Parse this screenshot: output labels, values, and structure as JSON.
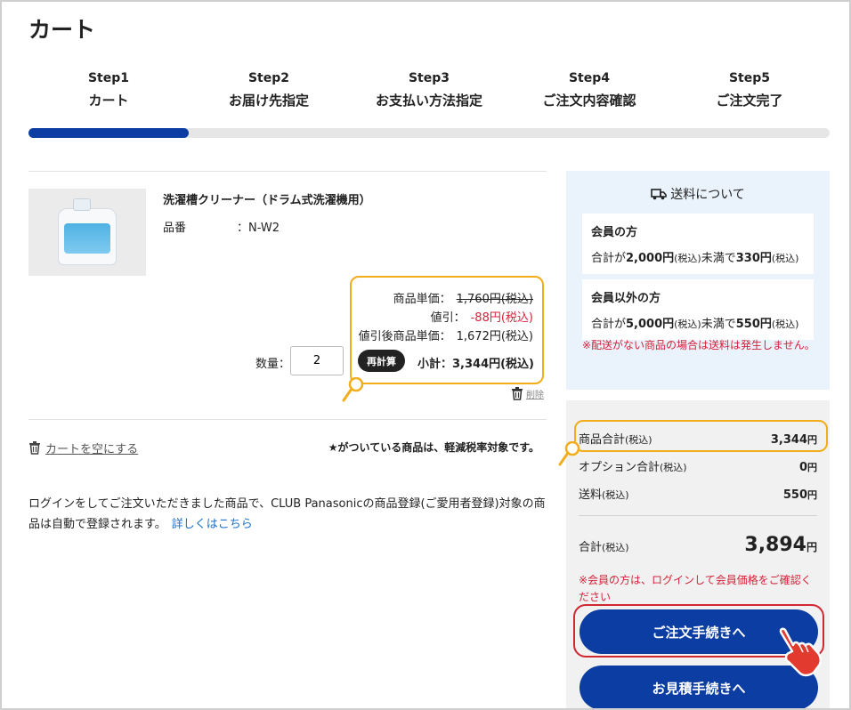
{
  "page": {
    "title": "カート"
  },
  "steps": [
    {
      "num": "Step1",
      "label": "カート"
    },
    {
      "num": "Step2",
      "label": "お届け先指定"
    },
    {
      "num": "Step3",
      "label": "お支払い方法指定"
    },
    {
      "num": "Step4",
      "label": "ご注文内容確認"
    },
    {
      "num": "Step5",
      "label": "ご注文完了"
    }
  ],
  "progress": {
    "current_step": 1,
    "total_steps": 5,
    "fraction": 0.2
  },
  "item": {
    "name": "洗濯槽クリーナー（ドラム式洗濯機用）",
    "hinban_label": "品番",
    "hinban_value": "：N-W2",
    "unit_price_label": "商品単価：",
    "unit_price": "1,760円(税込)",
    "discount_label": "値引：",
    "discount": "-88円(税込)",
    "discounted_price_label": "値引後商品単価：",
    "discounted_price": "1,672円(税込)",
    "qty_label": "数量：",
    "qty": "2",
    "recalc_label": "再計算",
    "subtotal": "小計：3,344円(税込)",
    "delete_label": "削除"
  },
  "cart": {
    "empty_label": "カートを空にする",
    "tax_note": "★がついている商品は、軽減税率対象です。",
    "login_note": "ログインをしてご注文いただきました商品で、CLUB Panasonicの商品登録(ご愛用者登録)対象の商品は自動で登録されます。",
    "details_link": "詳しくはこちら"
  },
  "shipping": {
    "title": "送料について",
    "member_title": "会員の方",
    "member_text_1": "合計が",
    "member_amount": "2,000円",
    "member_text_2": "(税込)",
    "member_text_3": "未満で",
    "member_fee": "330円",
    "member_text_4": "(税込)",
    "nonmember_title": "会員以外の方",
    "nonmember_text_1": "合計が",
    "nonmember_amount": "5,000円",
    "nonmember_text_2": "(税込)",
    "nonmember_text_3": "未満で",
    "nonmember_fee": "550円",
    "nonmember_text_4": "(税込)",
    "warning": "※配送がない商品の場合は送料は発生しません。"
  },
  "summary": {
    "goods_label": "商品合計",
    "goods_tax": "(税込)",
    "goods_value": "3,344",
    "option_label": "オプション合計",
    "option_tax": "(税込)",
    "option_value": "0",
    "shipping_label": "送料",
    "shipping_tax": "(税込)",
    "shipping_value": "550",
    "total_label": "合計",
    "total_tax": "(税込)",
    "total_value": "3,894",
    "currency": "円",
    "member_note": "※会員の方は、ログインして会員価格をご確認ください"
  },
  "buttons": {
    "order": "ご注文手続きへ",
    "estimate": "お見積手続きへ"
  },
  "colors": {
    "primary": "#0b3da3",
    "highlight": "#f2ad1a",
    "warning": "#d4233a",
    "ship_bg": "#eaf2fb"
  }
}
